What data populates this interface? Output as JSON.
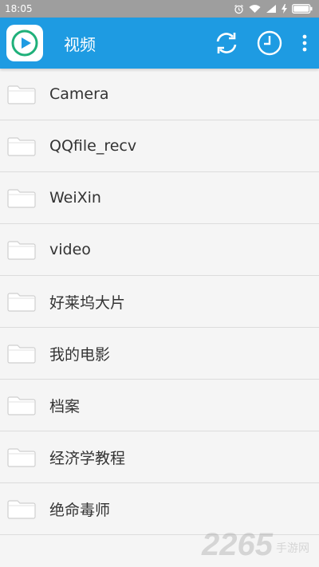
{
  "status_bar": {
    "time": "18:05"
  },
  "app_bar": {
    "title": "视频",
    "logo_icon": "video-play-icon",
    "actions": [
      "refresh-icon",
      "history-clock-icon",
      "more-vert-icon"
    ],
    "color": "#1e9be2"
  },
  "folders": [
    {
      "label": "Camera"
    },
    {
      "label": "QQfile_recv"
    },
    {
      "label": "WeiXin"
    },
    {
      "label": "video"
    },
    {
      "label": "好莱坞大片"
    },
    {
      "label": "我的电影"
    },
    {
      "label": "档案"
    },
    {
      "label": "经济学教程"
    },
    {
      "label": "绝命毒师"
    }
  ],
  "watermark": {
    "number": "2265",
    "text": "手游网"
  }
}
